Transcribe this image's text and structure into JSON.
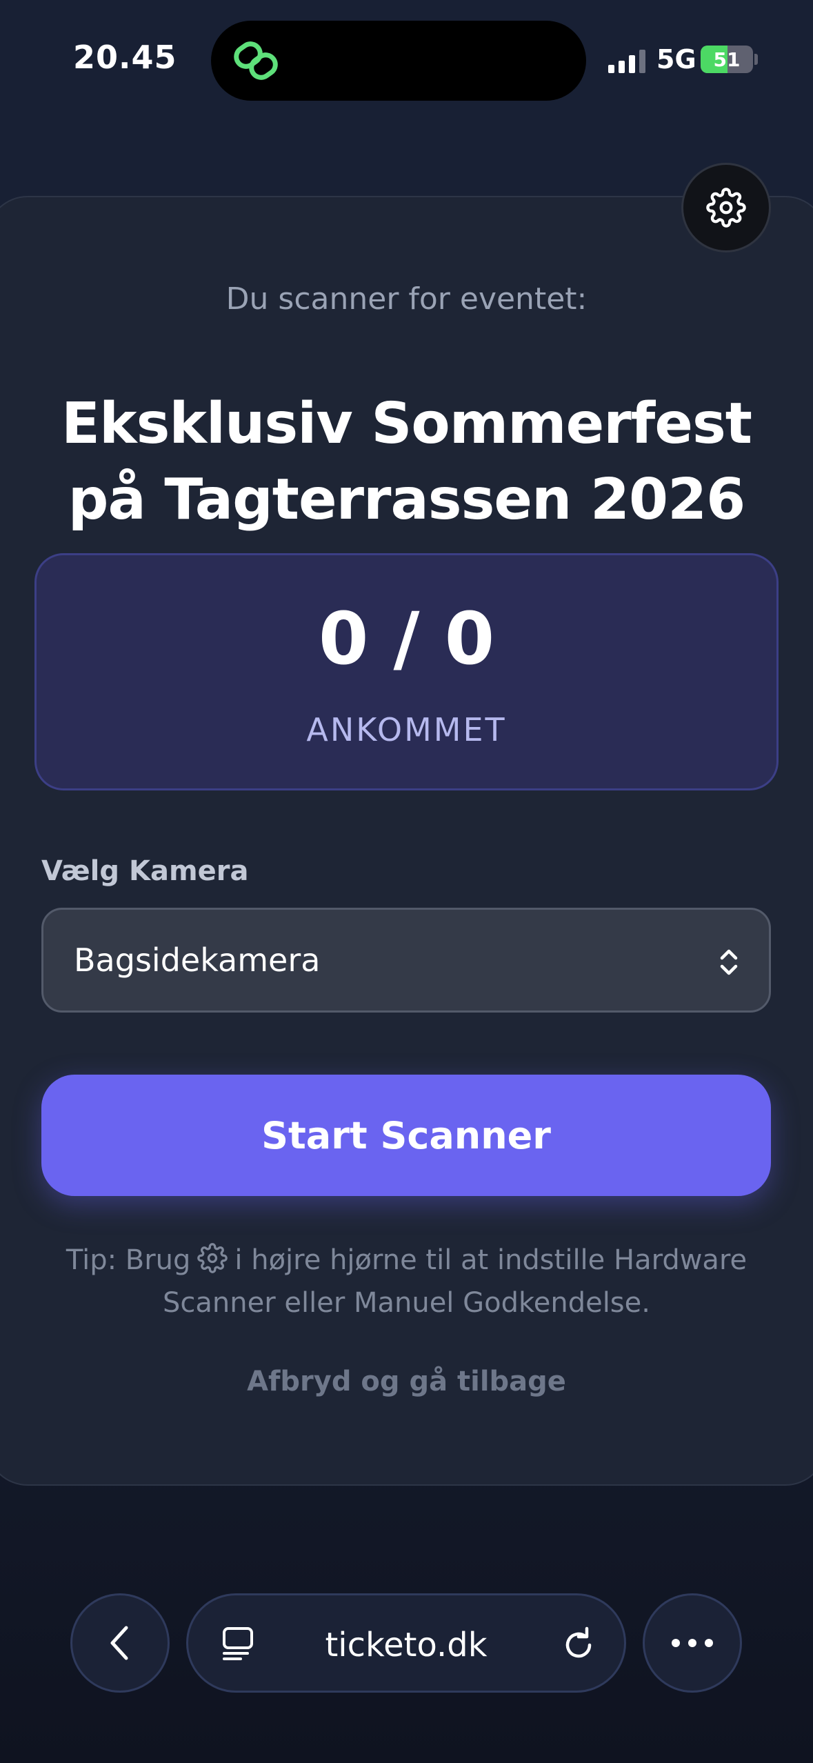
{
  "status_bar": {
    "time": "20.45",
    "network": "5G",
    "battery": "51",
    "battery_level": 0.51
  },
  "card": {
    "subtitle": "Du scanner for eventet:",
    "event_title": "Eksklusiv Sommerfest på Tagterrassen 2026",
    "counter": {
      "value": "0 / 0",
      "label": "ANKOMMET"
    },
    "camera": {
      "label": "Vælg Kamera",
      "selected": "Bagsidekamera"
    },
    "start_button": "Start Scanner",
    "tip_before": "Tip: Brug",
    "tip_after": "i højre hjørne til at indstille Hardware Scanner eller Manuel Godkendelse.",
    "back_link": "Afbryd og gå tilbage"
  },
  "browser": {
    "url": "ticketo.dk"
  },
  "colors": {
    "accent": "#6a64f0",
    "background": "#182034",
    "card": "#1e2535",
    "counter_box": "#2a2c55",
    "battery_green": "#4cd964",
    "island_app_green": "#5ee07a"
  },
  "icons": [
    "link-app-icon",
    "gear-icon",
    "chevron-updown-icon",
    "back-chevron-icon",
    "tabs-icon",
    "reload-icon",
    "more-icon"
  ]
}
